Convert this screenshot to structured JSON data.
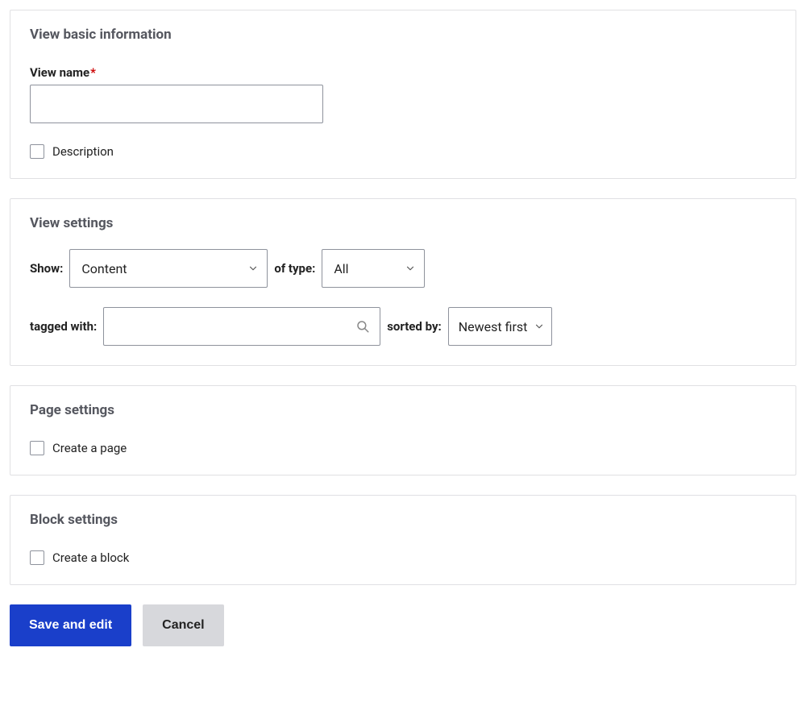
{
  "basic": {
    "title": "View basic information",
    "viewNameLabel": "View name",
    "required": "*",
    "viewNameValue": "",
    "descriptionLabel": "Description"
  },
  "viewSettings": {
    "title": "View settings",
    "showLabel": "Show:",
    "showValue": "Content",
    "ofTypeLabel": "of type:",
    "ofTypeValue": "All",
    "taggedWithLabel": "tagged with:",
    "taggedWithValue": "",
    "sortedByLabel": "sorted by:",
    "sortedByValue": "Newest first"
  },
  "pageSettings": {
    "title": "Page settings",
    "createPageLabel": "Create a page"
  },
  "blockSettings": {
    "title": "Block settings",
    "createBlockLabel": "Create a block"
  },
  "actions": {
    "save": "Save and edit",
    "cancel": "Cancel"
  }
}
